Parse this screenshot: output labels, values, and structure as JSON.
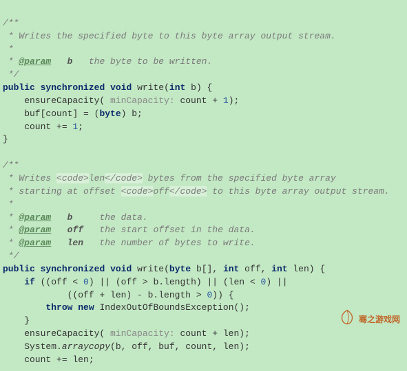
{
  "doc1": {
    "open": "/**",
    "l1": " * Writes the specified byte to this byte array output stream.",
    "l2": " *",
    "l3_pre": " * ",
    "l3_tag": "@param",
    "l3_sp": "   ",
    "l3_name": "b",
    "l3_desc": "   the byte to be written.",
    "close": " */"
  },
  "m1": {
    "kw_public": "public",
    "kw_sync": "synchronized",
    "kw_void": "void",
    "name": "write",
    "params_open": "(",
    "type_int": "int",
    "pname": " b",
    "params_close": ") {",
    "body_ensure_pre": "    ensureCapacity( ",
    "hint_minCap": "minCapacity:",
    "body_ensure_post": " count + ",
    "num1": "1",
    "body_ensure_end": ");",
    "body_buf_pre": "    buf[count] = (",
    "cast_byte": "byte",
    "body_buf_post": ") b;",
    "body_count_pre": "    count += ",
    "body_count_num": "1",
    "body_count_end": ";",
    "close": "}"
  },
  "doc2": {
    "open": "/**",
    "l1_pre": " * Writes ",
    "l1_code_open": "<code>",
    "l1_code_txt": "len",
    "l1_code_close": "</code>",
    "l1_post": " bytes from the specified byte array",
    "l2_pre": " * starting at offset ",
    "l2_code_open": "<code>",
    "l2_code_txt": "off",
    "l2_code_close": "</code>",
    "l2_post": " to this byte array output stream.",
    "l3": " *",
    "p1_pre": " * ",
    "p1_tag": "@param",
    "p1_sp": "   ",
    "p1_name": "b",
    "p1_desc": "     the data.",
    "p2_pre": " * ",
    "p2_tag": "@param",
    "p2_sp": "   ",
    "p2_name": "off",
    "p2_desc": "   the start offset in the data.",
    "p3_pre": " * ",
    "p3_tag": "@param",
    "p3_sp": "   ",
    "p3_name": "len",
    "p3_desc": "   the number of bytes to write.",
    "close": " */"
  },
  "m2": {
    "kw_public": "public",
    "kw_sync": "synchronized",
    "kw_void": "void",
    "name": "write",
    "params_open": "(",
    "type_byte": "byte",
    "arr": " b[], ",
    "type_int1": "int",
    "pn_off": " off, ",
    "type_int2": "int",
    "pn_len": " len",
    "params_close": ") {",
    "if_pre": "    ",
    "kw_if": "if",
    "if_l1_a": " ((off < ",
    "z1": "0",
    "if_l1_b": ") || (off > b.",
    "len_prop": "length",
    "if_l1_c": ") || (len < ",
    "z2": "0",
    "if_l1_d": ") ||",
    "if_l2_a": "            ((off + len) - b.",
    "len_prop2": "length",
    "if_l2_b": " > ",
    "z3": "0",
    "if_l2_c": ")) {",
    "throw_pre": "        ",
    "kw_throw": "throw",
    "kw_new": "new",
    "exc": " IndexOutOfBoundsException();",
    "if_close": "    }",
    "ensure_pre": "    ensureCapacity( ",
    "hint_minCap": "minCapacity:",
    "ensure_post": " count + len);",
    "arraycopy_pre": "    System.",
    "arraycopy": "arraycopy",
    "arraycopy_post": "(b, off, buf, count, len);",
    "count_line": "    count += len;"
  },
  "watermark": {
    "text": "骞之游戏网"
  }
}
